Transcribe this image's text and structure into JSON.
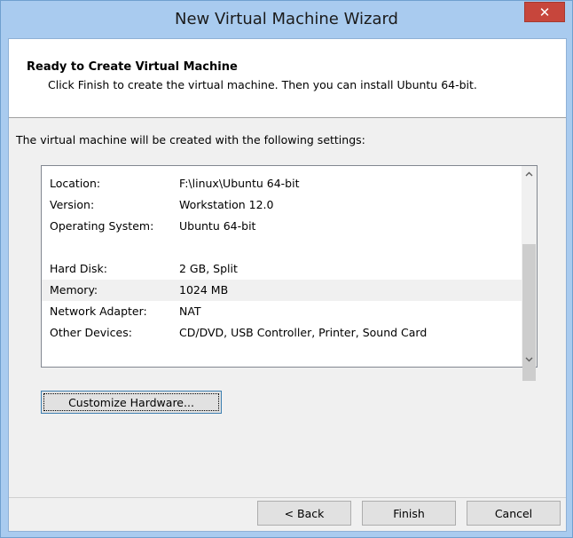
{
  "window": {
    "title": "New Virtual Machine Wizard",
    "close_glyph": "✕"
  },
  "header": {
    "title": "Ready to Create Virtual Machine",
    "subtitle": "Click Finish to create the virtual machine. Then you can install Ubuntu 64-bit."
  },
  "intro": "The virtual machine will be created with the following settings:",
  "settings": [
    {
      "label": "Location:",
      "value": "F:\\linux\\Ubuntu 64-bit"
    },
    {
      "label": "Version:",
      "value": "Workstation 12.0"
    },
    {
      "label": "Operating System:",
      "value": "Ubuntu 64-bit"
    },
    {
      "label": "Hard Disk:",
      "value": "2 GB, Split"
    },
    {
      "label": "Memory:",
      "value": "1024 MB"
    },
    {
      "label": "Network Adapter:",
      "value": "NAT"
    },
    {
      "label": "Other Devices:",
      "value": "CD/DVD, USB Controller, Printer, Sound Card"
    }
  ],
  "buttons": {
    "customize_label": "Customize Hardware...",
    "back_label": "< Back",
    "finish_label": "Finish",
    "cancel_label": "Cancel"
  },
  "icons": {
    "scroll_up": "chevron-up-icon",
    "scroll_down": "chevron-down-icon",
    "close": "close-icon"
  }
}
